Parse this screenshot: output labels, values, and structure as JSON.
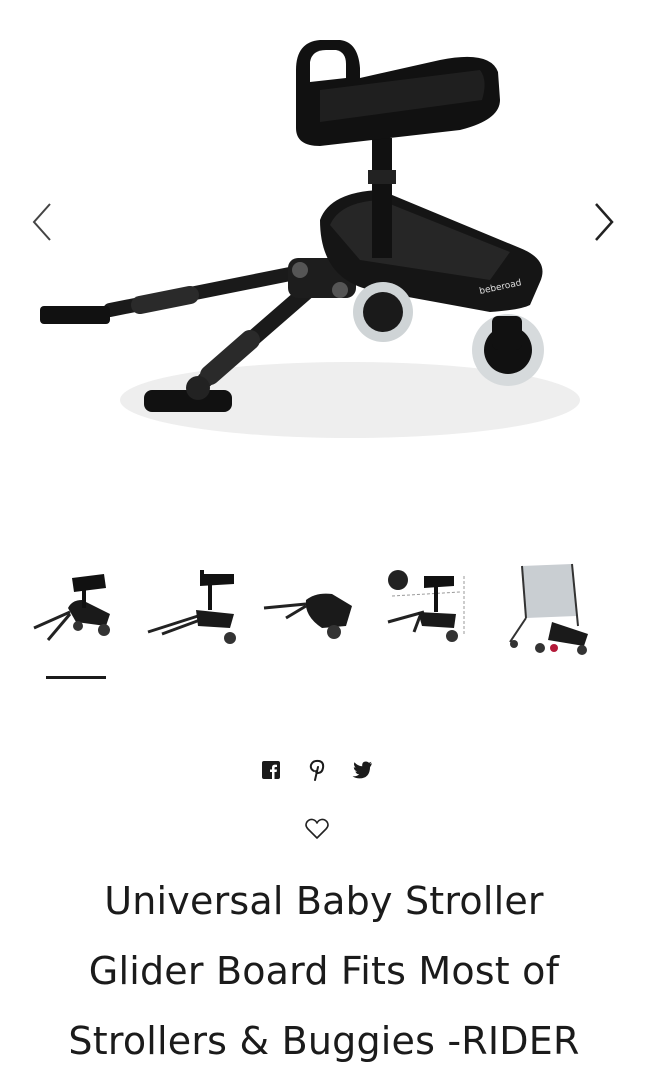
{
  "gallery": {
    "main_image": {
      "icon": "product-image-glider-board",
      "brand_mark": "beberoad"
    },
    "prev_icon": "chevron-left-icon",
    "next_icon": "chevron-right-icon",
    "thumbnails": [
      {
        "name": "thumbnail-1",
        "selected": true
      },
      {
        "name": "thumbnail-2",
        "selected": false
      },
      {
        "name": "thumbnail-3",
        "selected": false
      },
      {
        "name": "thumbnail-4",
        "selected": false
      },
      {
        "name": "thumbnail-5",
        "selected": false
      }
    ]
  },
  "share": {
    "icons": [
      "facebook-icon",
      "pinterest-icon",
      "twitter-icon"
    ]
  },
  "wishlist": {
    "icon": "heart-icon"
  },
  "product": {
    "title_lines": [
      "Universal Baby Stroller",
      "Glider Board Fits Most of",
      "Strollers & Buggies -RIDER"
    ]
  }
}
